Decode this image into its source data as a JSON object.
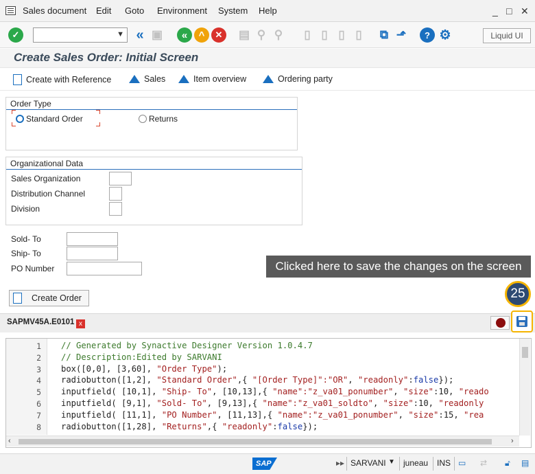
{
  "menu": {
    "items": [
      "Sales document",
      "Edit",
      "Goto",
      "Environment",
      "System",
      "Help"
    ],
    "window_controls": [
      "_",
      "□",
      "✕"
    ]
  },
  "toolbar": {
    "liquid_ui": "Liquid UI",
    "icons": [
      "check-icon",
      "back-icon",
      "exit-icon",
      "cancel-icon",
      "help-icon",
      "settings-icon"
    ]
  },
  "screen": {
    "title": "Create Sales Order: Initial Screen"
  },
  "app_toolbar": {
    "create_with_reference": "Create with Reference",
    "sales": "Sales",
    "item_overview": "Item overview",
    "ordering_party": "Ordering party"
  },
  "order_type": {
    "title": "Order Type",
    "standard_order": "Standard Order",
    "returns": "Returns"
  },
  "org_data": {
    "title": "Organizational Data",
    "sales_organization": "Sales Organization",
    "distribution_channel": "Distribution Channel",
    "division": "Division"
  },
  "fields": {
    "sold_to": "Sold- To",
    "ship_to": "Ship- To",
    "po_number": "PO Number"
  },
  "create_order": "Create Order",
  "tooltip": "Clicked here to save the changes on the screen",
  "step_badge": "25",
  "editor": {
    "tab_label": "SAPMV45A.E0101",
    "tab_close": "x",
    "lines": [
      {
        "n": "1",
        "parts": [
          {
            "c": "c-comment",
            "t": "// Generated by Synactive Designer Version 1.0.4.7"
          }
        ]
      },
      {
        "n": "2",
        "parts": [
          {
            "c": "c-comment",
            "t": "// Description:Edited by SARVANI"
          }
        ]
      },
      {
        "n": "3",
        "parts": [
          {
            "c": "c-ident",
            "t": "box([0,0], [3,60], "
          },
          {
            "c": "c-str",
            "t": "\"Order Type\""
          },
          {
            "c": "c-ident",
            "t": ");"
          }
        ]
      },
      {
        "n": "4",
        "parts": [
          {
            "c": "c-ident",
            "t": "radiobutton([1,2], "
          },
          {
            "c": "c-str",
            "t": "\"Standard Order\""
          },
          {
            "c": "c-ident",
            "t": ",{ "
          },
          {
            "c": "c-str",
            "t": "\"[Order Type]\":\"OR\""
          },
          {
            "c": "c-ident",
            "t": ", "
          },
          {
            "c": "c-str",
            "t": "\"readonly\""
          },
          {
            "c": "c-ident",
            "t": ":"
          },
          {
            "c": "c-kw",
            "t": "false"
          },
          {
            "c": "c-ident",
            "t": "});"
          }
        ]
      },
      {
        "n": "5",
        "parts": [
          {
            "c": "c-ident",
            "t": "inputfield( [10,1], "
          },
          {
            "c": "c-str",
            "t": "\"Ship- To\""
          },
          {
            "c": "c-ident",
            "t": ", [10,13],{ "
          },
          {
            "c": "c-str",
            "t": "\"name\":\"z_va01_ponumber\""
          },
          {
            "c": "c-ident",
            "t": ", "
          },
          {
            "c": "c-str",
            "t": "\"size\""
          },
          {
            "c": "c-ident",
            "t": ":10, "
          },
          {
            "c": "c-str",
            "t": "\"reado"
          }
        ]
      },
      {
        "n": "6",
        "parts": [
          {
            "c": "c-ident",
            "t": "inputfield( [9,1], "
          },
          {
            "c": "c-str",
            "t": "\"Sold- To\""
          },
          {
            "c": "c-ident",
            "t": ", [9,13],{ "
          },
          {
            "c": "c-str",
            "t": "\"name\":\"z_va01_soldto\""
          },
          {
            "c": "c-ident",
            "t": ", "
          },
          {
            "c": "c-str",
            "t": "\"size\""
          },
          {
            "c": "c-ident",
            "t": ":10, "
          },
          {
            "c": "c-str",
            "t": "\"readonly"
          }
        ]
      },
      {
        "n": "7",
        "parts": [
          {
            "c": "c-ident",
            "t": "inputfield( [11,1], "
          },
          {
            "c": "c-str",
            "t": "\"PO Number\""
          },
          {
            "c": "c-ident",
            "t": ", [11,13],{ "
          },
          {
            "c": "c-str",
            "t": "\"name\":\"z_va01_ponumber\""
          },
          {
            "c": "c-ident",
            "t": ", "
          },
          {
            "c": "c-str",
            "t": "\"size\""
          },
          {
            "c": "c-ident",
            "t": ":15, "
          },
          {
            "c": "c-str",
            "t": "\"rea"
          }
        ]
      },
      {
        "n": "8",
        "parts": [
          {
            "c": "c-ident",
            "t": "radiobutton([1,28], "
          },
          {
            "c": "c-str",
            "t": "\"Returns\""
          },
          {
            "c": "c-ident",
            "t": ",{ "
          },
          {
            "c": "c-str",
            "t": "\"readonly\""
          },
          {
            "c": "c-ident",
            "t": ":"
          },
          {
            "c": "c-kw",
            "t": "false"
          },
          {
            "c": "c-ident",
            "t": "});"
          }
        ]
      }
    ]
  },
  "status": {
    "brand": "SAP",
    "user": "SARVANI",
    "server": "juneau",
    "mode": "INS"
  }
}
